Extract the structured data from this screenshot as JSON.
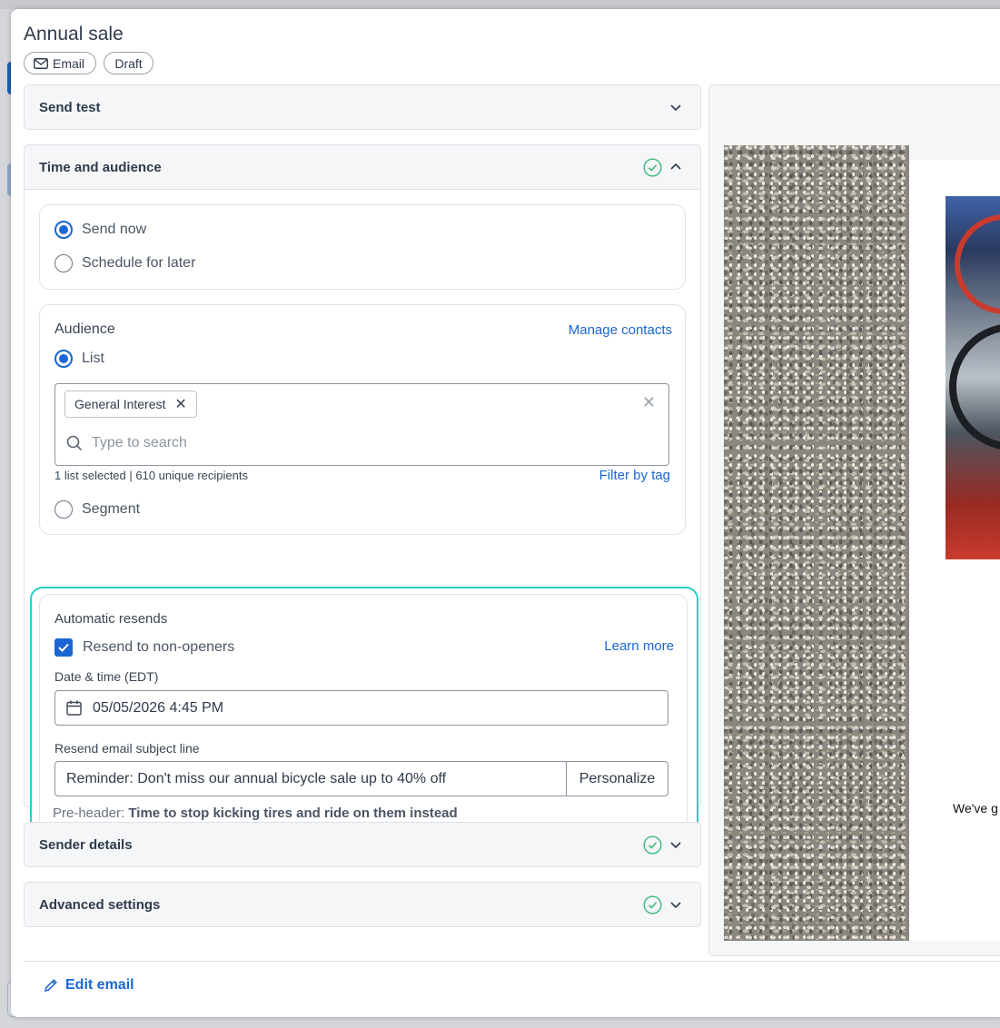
{
  "header": {
    "title": "Annual sale",
    "pills": {
      "email": "Email",
      "draft": "Draft"
    }
  },
  "sections": {
    "send_test": {
      "label": "Send test"
    },
    "time_audience": {
      "label": "Time and audience",
      "send_options": {
        "send_now": "Send now",
        "schedule_later": "Schedule for later",
        "selected": "Send now"
      },
      "audience": {
        "label": "Audience",
        "manage_link": "Manage contacts",
        "list_option": "List",
        "selected_tag": "General Interest",
        "search_placeholder": "Type to search",
        "selection_info": "1 list selected | 610 unique recipients",
        "filter_link": "Filter by tag",
        "segment_option": "Segment"
      },
      "resends": {
        "label": "Automatic resends",
        "checkbox_label": "Resend to non-openers",
        "checked": true,
        "learn_more": "Learn more",
        "date_label": "Date & time (EDT)",
        "date_value": "05/05/2026 4:45 PM",
        "subject_label": "Resend email subject line",
        "subject_value": "Reminder: Don't miss our annual bicycle sale up to 40% off",
        "personalize": "Personalize",
        "preheader_prefix": "Pre-header:",
        "preheader_value": "Time to stop kicking tires and ride on them instead"
      }
    },
    "sender_details": {
      "label": "Sender details"
    },
    "advanced_settings": {
      "label": "Advanced settings"
    }
  },
  "footer": {
    "edit_email": "Edit email"
  },
  "preview": {
    "snippet": "We've g"
  },
  "colors": {
    "accent": "#1a66d2",
    "highlight": "#27d0c5",
    "success": "#3cb878"
  },
  "icons": [
    "envelope-icon",
    "chevron-down-icon",
    "chevron-up-icon",
    "check-circle-icon",
    "close-icon",
    "search-icon",
    "calendar-icon",
    "checkmark-icon",
    "pencil-icon"
  ]
}
